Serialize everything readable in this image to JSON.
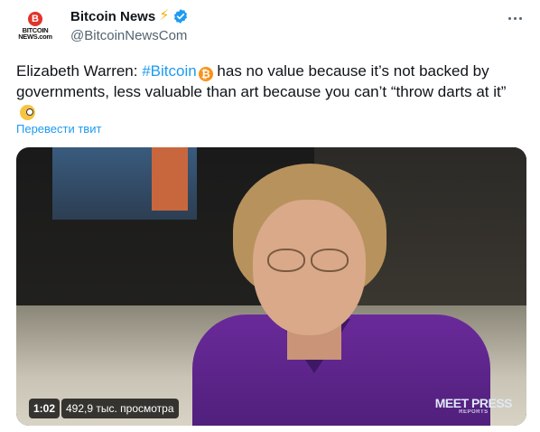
{
  "author": {
    "avatar_logo_top": "B",
    "avatar_logo_line1": "BITCOIN",
    "avatar_logo_line2": "NEWS.com",
    "display_name": "Bitcoin News",
    "emoji": "⚡",
    "handle": "@BitcoinNewsCom",
    "verified_color": "#1d9bf0"
  },
  "tweet": {
    "text_before": "Elizabeth Warren: ",
    "hashtag": "#Bitcoin",
    "text_after": "  has no value because it’s not backed by governments, less valuable than art because you can’t “throw darts at it” ",
    "btc_symbol": "₿",
    "translate_label": "Перевести твит"
  },
  "video": {
    "duration": "1:02",
    "views": "492,9 тыс. просмотра",
    "watermark_line1": "MEET PRESS",
    "watermark_line2": "REPORTS"
  },
  "colors": {
    "link": "#1d9bf0",
    "bitcoin_orange": "#f7931a",
    "brand_red": "#e0342b"
  }
}
